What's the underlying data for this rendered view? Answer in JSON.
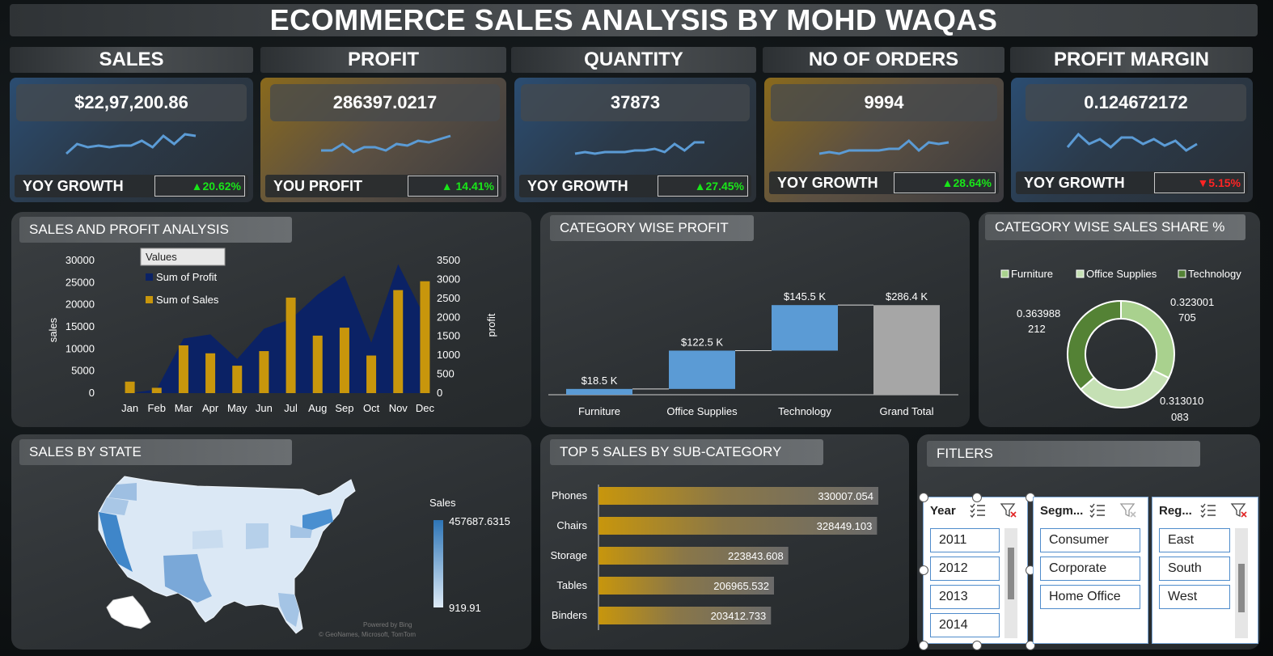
{
  "title": "ECOMMERCE SALES ANALYSIS BY MOHD WAQAS",
  "colors": {
    "blue_series": "#5b9bd5",
    "gold_series": "#c8960c",
    "navy_series": "#0b2265",
    "up": "#19e619",
    "down": "#ff2424"
  },
  "kpis": [
    {
      "header": "SALES",
      "value": "$22,97,200.86",
      "footer": "YOY GROWTH",
      "change": "▲20.62%",
      "trend": "up",
      "spark": [
        6,
        12,
        10,
        11,
        10,
        11,
        11,
        14,
        10,
        17,
        12,
        18,
        17
      ]
    },
    {
      "header": "PROFIT",
      "value": "286397.0217",
      "footer": "YOU PROFIT",
      "change": "▲ 14.41%",
      "trend": "up",
      "spark": [
        8,
        8,
        12,
        7,
        10,
        10,
        8,
        12,
        11,
        14,
        13,
        15,
        17
      ]
    },
    {
      "header": "QUANTITY",
      "value": "37873",
      "footer": "YOY GROWTH",
      "change": "▲27.45%",
      "trend": "up",
      "spark": [
        6,
        7,
        6,
        7,
        7,
        7,
        8,
        8,
        9,
        7,
        12,
        8,
        13,
        13
      ]
    },
    {
      "header": "NO OF ORDERS",
      "value": "9994",
      "footer": "YOY GROWTH",
      "change": "▲28.64%",
      "trend": "up",
      "spark": [
        6,
        7,
        6,
        8,
        8,
        8,
        8,
        9,
        9,
        14,
        8,
        13,
        12,
        13
      ]
    },
    {
      "header": "PROFIT MARGIN",
      "value": "0.124672172",
      "footer": "YOY GROWTH",
      "change": "▼5.15%",
      "trend": "down",
      "spark": [
        10,
        18,
        12,
        15,
        10,
        16,
        16,
        12,
        15,
        11,
        14,
        8,
        12
      ]
    }
  ],
  "sales_profit": {
    "heading": "SALES AND PROFIT ANALYSIS",
    "legend_title": "Values",
    "legend_profit": "Sum of Profit",
    "legend_sales": "Sum of Sales",
    "ylabel_left": "sales",
    "ylabel_right": "profit"
  },
  "category_profit": {
    "heading": "CATEGORY WISE PROFIT"
  },
  "category_share": {
    "heading": "CATEGORY WISE SALES SHARE %",
    "legend": [
      "Furniture",
      "Office Supplies",
      "Technology"
    ],
    "label_furniture": [
      "0.323001",
      "705"
    ],
    "label_office": [
      "0.313010",
      "083"
    ],
    "label_tech": [
      "0.363988",
      "212"
    ]
  },
  "state_map": {
    "heading": "SALES BY STATE",
    "legend_title": "Sales",
    "legend_max": "457687.6315",
    "legend_min": "919.91",
    "attribution_1": "Powered by Bing",
    "attribution_2": "© GeoNames, Microsoft, TomTom"
  },
  "subcat": {
    "heading": "TOP 5 SALES BY SUB-CATEGORY"
  },
  "filters": {
    "heading": "FITLERS",
    "year": {
      "title": "Year",
      "items": [
        "2011",
        "2012",
        "2013",
        "2014"
      ]
    },
    "segment": {
      "title": "Segm...",
      "items": [
        "Consumer",
        "Corporate",
        "Home Office"
      ]
    },
    "region": {
      "title": "Reg...",
      "items": [
        "East",
        "South",
        "West"
      ]
    }
  },
  "chart_data": [
    {
      "type": "bar",
      "title": "SALES AND PROFIT ANALYSIS",
      "categories": [
        "Jan",
        "Feb",
        "Mar",
        "Apr",
        "May",
        "Jun",
        "Jul",
        "Aug",
        "Sep",
        "Oct",
        "Nov",
        "Dec"
      ],
      "series": [
        {
          "name": "Sum of Sales",
          "axis": "left",
          "render": "bar",
          "values": [
            2600,
            1200,
            10800,
            9000,
            6200,
            9500,
            21600,
            13000,
            14800,
            8500,
            23300,
            25300
          ]
        },
        {
          "name": "Sum of Profit",
          "axis": "right",
          "render": "area",
          "values": [
            0,
            100,
            1440,
            1550,
            900,
            1700,
            1950,
            2600,
            3100,
            1330,
            3400,
            2000
          ]
        }
      ],
      "ylabel": "sales",
      "ylim": [
        0,
        30000
      ],
      "yticks": [
        0,
        5000,
        10000,
        15000,
        20000,
        25000,
        30000
      ],
      "y2label": "profit",
      "y2lim": [
        0,
        3500
      ],
      "y2ticks": [
        0,
        500,
        1000,
        1500,
        2000,
        2500,
        3000,
        3500
      ],
      "legend": "top-left"
    },
    {
      "type": "bar",
      "title": "CATEGORY WISE PROFIT",
      "subtype": "waterfall",
      "categories": [
        "Furniture",
        "Office Supplies",
        "Technology",
        "Grand Total"
      ],
      "values": [
        18.5,
        122.5,
        145.5,
        286.4
      ],
      "labels": [
        "$18.5 K",
        "$122.5 K",
        "$145.5 K",
        "$286.4 K"
      ],
      "ylim": [
        0,
        300
      ]
    },
    {
      "type": "pie",
      "title": "CATEGORY WISE SALES SHARE %",
      "subtype": "doughnut",
      "categories": [
        "Furniture",
        "Office Supplies",
        "Technology"
      ],
      "values": [
        0.323001705,
        0.313010083,
        0.363988212
      ],
      "colors": [
        "#a9d18e",
        "#c5e0b4",
        "#548235"
      ],
      "legend": "top"
    },
    {
      "type": "bar",
      "title": "TOP 5 SALES BY SUB-CATEGORY",
      "orientation": "horizontal",
      "categories": [
        "Phones",
        "Chairs",
        "Storage",
        "Tables",
        "Binders"
      ],
      "values": [
        330007.054,
        328449.103,
        223843.608,
        206965.532,
        203412.733
      ],
      "labels": [
        "330007.054",
        "328449.103",
        "223843.608",
        "206965.532",
        "203412.733"
      ],
      "xlim": [
        0,
        330007.054
      ]
    }
  ]
}
